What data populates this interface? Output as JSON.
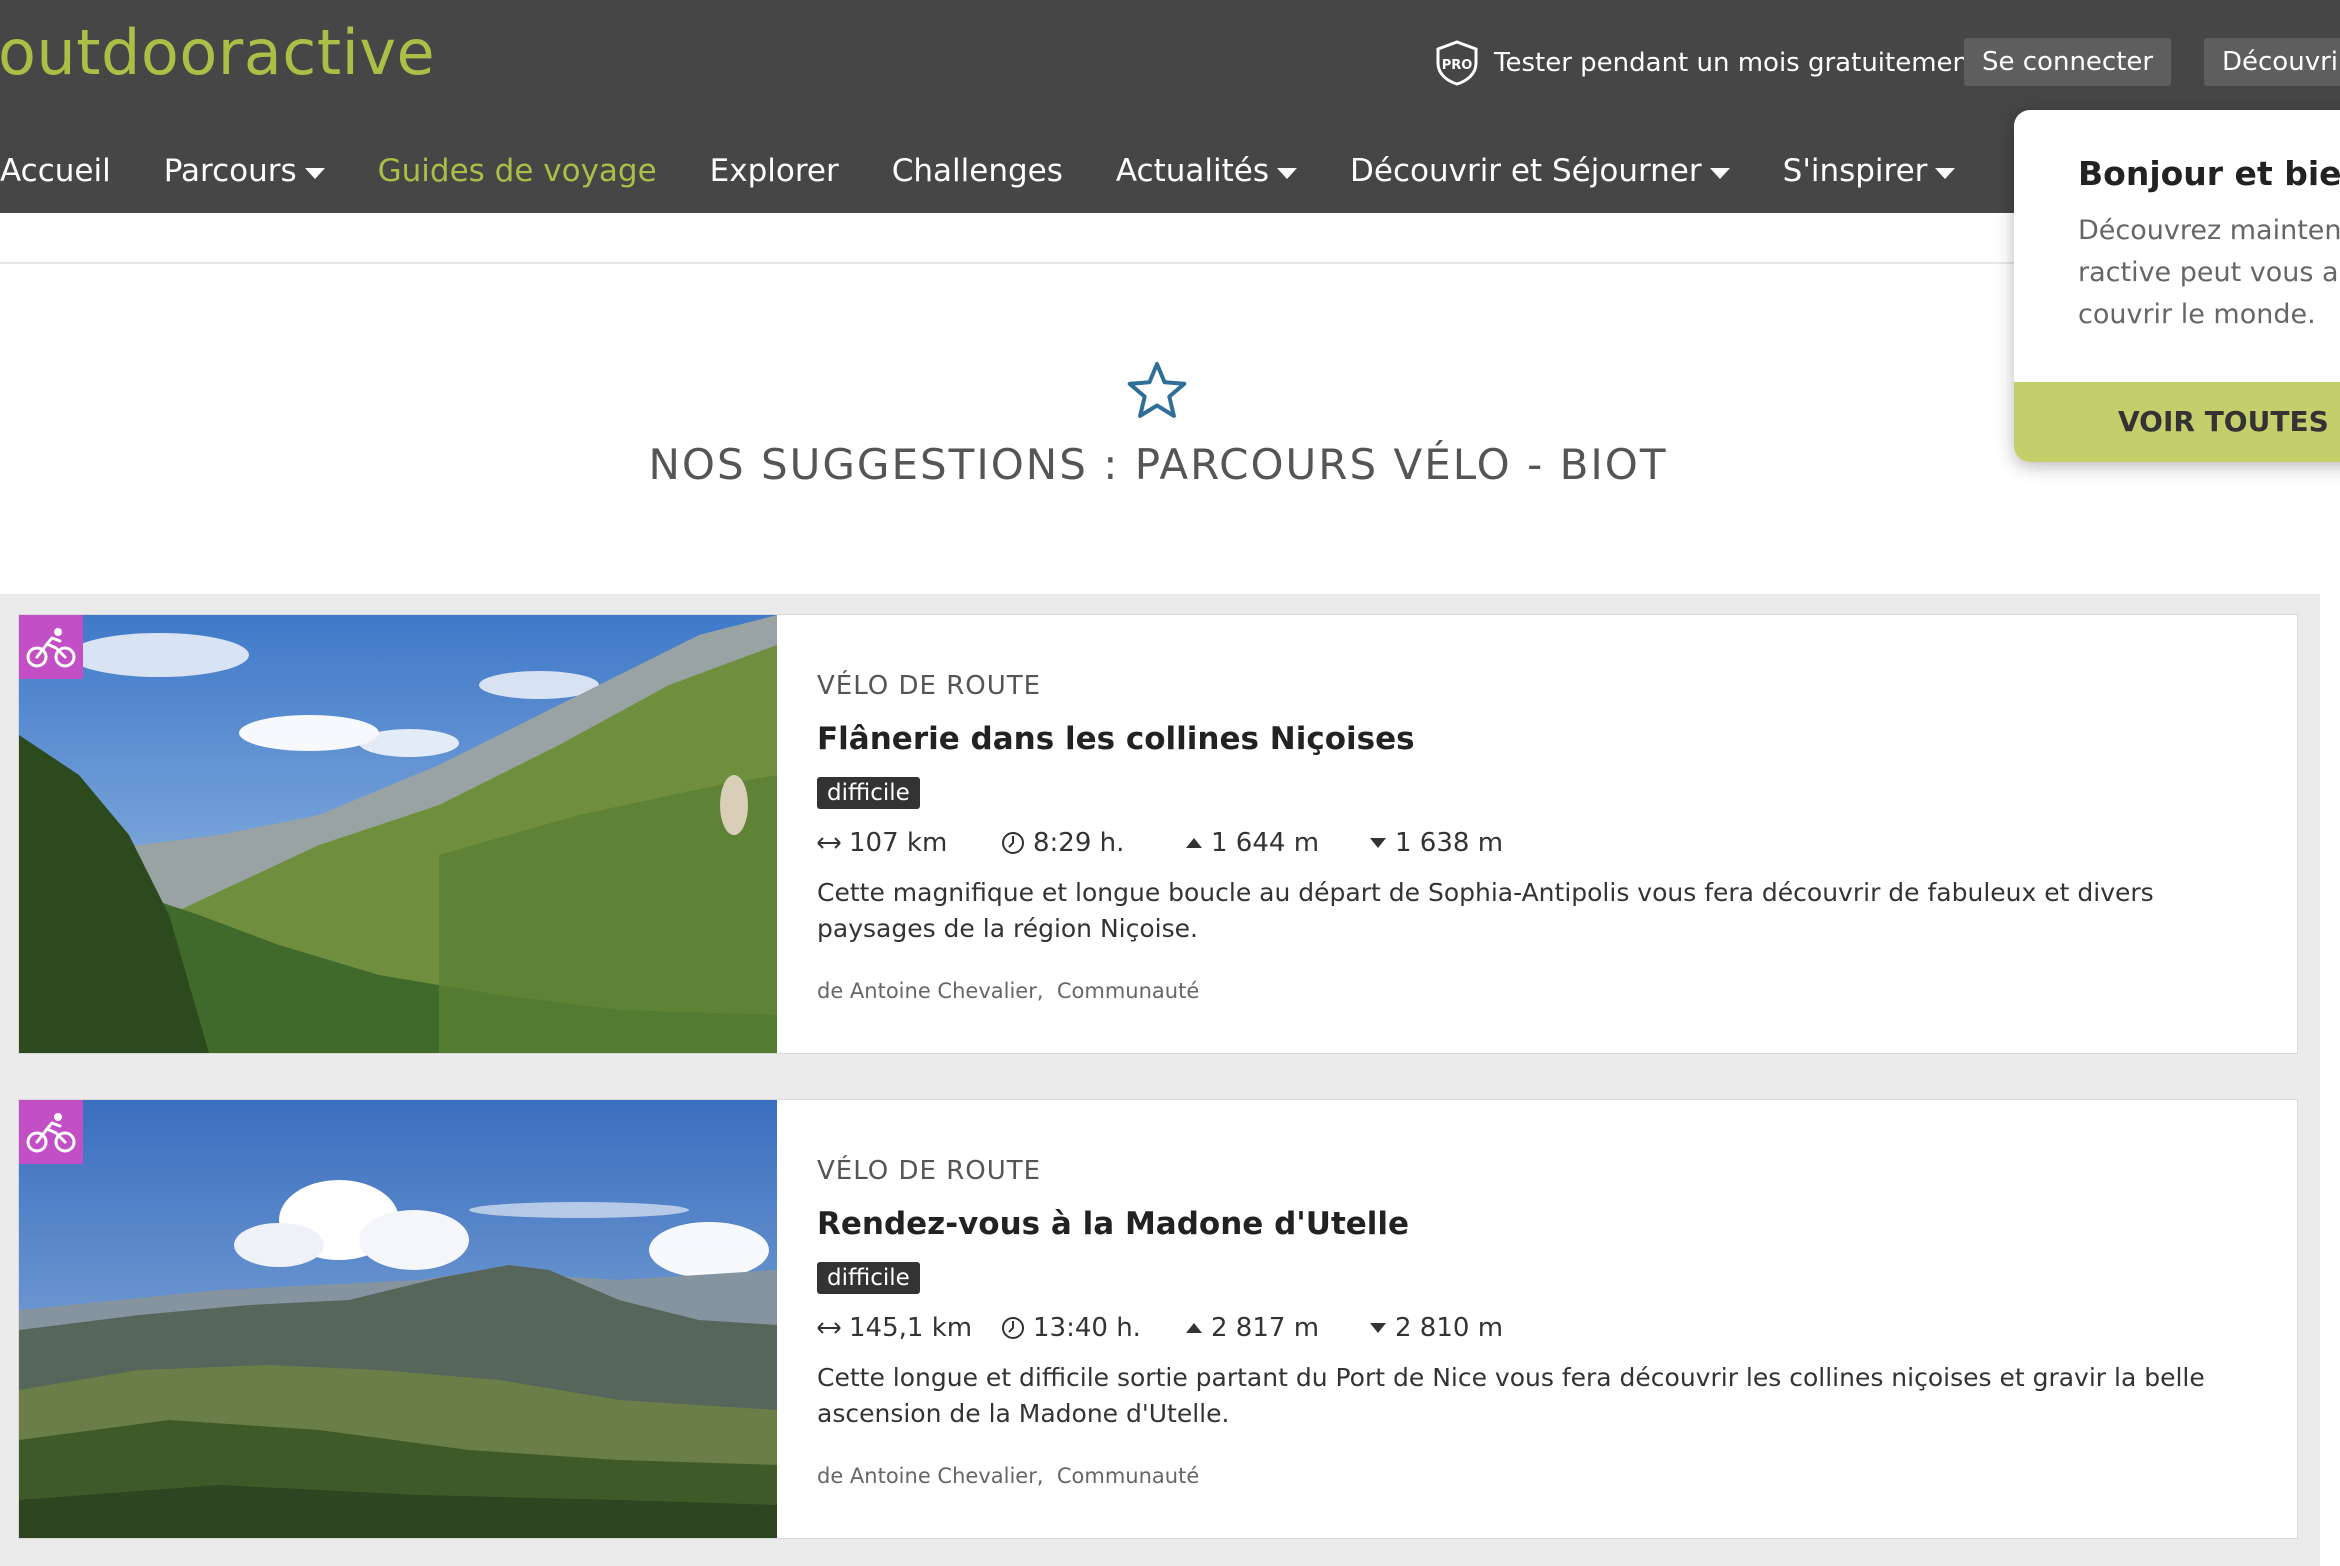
{
  "header": {
    "logo": "outdooractive",
    "pro_icon_text": "PRO",
    "pro_promo": "Tester pendant un mois gratuitement",
    "login": "Se connecter",
    "discover": "Découvrir",
    "nav": [
      {
        "label": "Accueil",
        "dropdown": false
      },
      {
        "label": "Parcours",
        "dropdown": true
      },
      {
        "label": "Guides de voyage",
        "dropdown": false,
        "active": true
      },
      {
        "label": "Explorer",
        "dropdown": false
      },
      {
        "label": "Challenges",
        "dropdown": false
      },
      {
        "label": "Actualités",
        "dropdown": true
      },
      {
        "label": "Découvrir et Séjourner",
        "dropdown": true
      },
      {
        "label": "S'inspirer",
        "dropdown": true
      }
    ]
  },
  "popup": {
    "title": "Bonjour et bienv",
    "lines": [
      "Découvrez mainten",
      "ractive peut vous ac",
      "couvrir le monde."
    ],
    "button": "VOIR TOUTES LE"
  },
  "section": {
    "icon": "star-outline-icon",
    "title": "NOS SUGGESTIONS : PARCOURS VÉLO - BIOT"
  },
  "cards": [
    {
      "category": "VÉLO DE ROUTE",
      "title": "Flânerie dans les collines Niçoises",
      "difficulty": "difficile",
      "distance": "107 km",
      "duration": "8:29 h.",
      "ascent": "1 644 m",
      "descent": "1 638 m",
      "description": "Cette magnifique et longue boucle au départ de Sophia-Antipolis vous fera découvrir de fabuleux et divers paysages de la région Niçoise.",
      "author": "de Antoine Chevalier,",
      "source": "Communauté"
    },
    {
      "category": "VÉLO DE ROUTE",
      "title": "Rendez-vous à la Madone d'Utelle",
      "difficulty": "difficile",
      "distance": "145,1 km",
      "duration": "13:40 h.",
      "ascent": "2 817 m",
      "descent": "2 810 m",
      "description": "Cette longue et difficile sortie partant du Port de Nice vous fera découvrir les collines niçoises et gravir la belle ascension de la Madone d'Utelle.",
      "author": "de Antoine Chevalier,",
      "source": "Communauté"
    }
  ],
  "colors": {
    "header_bg": "#464646",
    "brand_green": "#a9bf45",
    "popup_button": "#c3cf6a",
    "bike_badge": "#c24fc6",
    "star_icon": "#2f6e99"
  }
}
